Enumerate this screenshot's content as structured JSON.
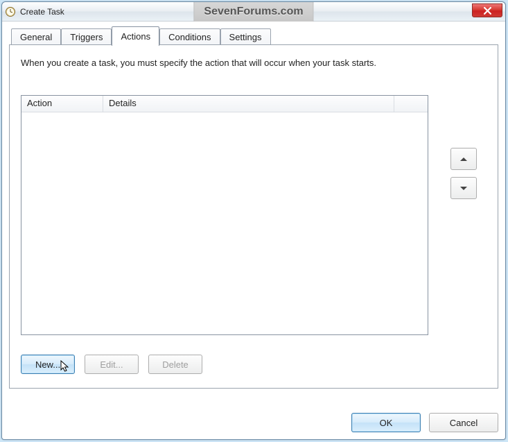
{
  "window": {
    "title": "Create Task",
    "watermark": "SevenForums.com"
  },
  "tabs": {
    "general": "General",
    "triggers": "Triggers",
    "actions": "Actions",
    "conditions": "Conditions",
    "settings": "Settings",
    "active": "actions"
  },
  "actions_panel": {
    "description": "When you create a task, you must specify the action that will occur when your task starts.",
    "columns": {
      "action": "Action",
      "details": "Details"
    },
    "rows": [],
    "buttons": {
      "new": "New...",
      "edit": "Edit...",
      "delete": "Delete"
    }
  },
  "dialog_buttons": {
    "ok": "OK",
    "cancel": "Cancel"
  }
}
